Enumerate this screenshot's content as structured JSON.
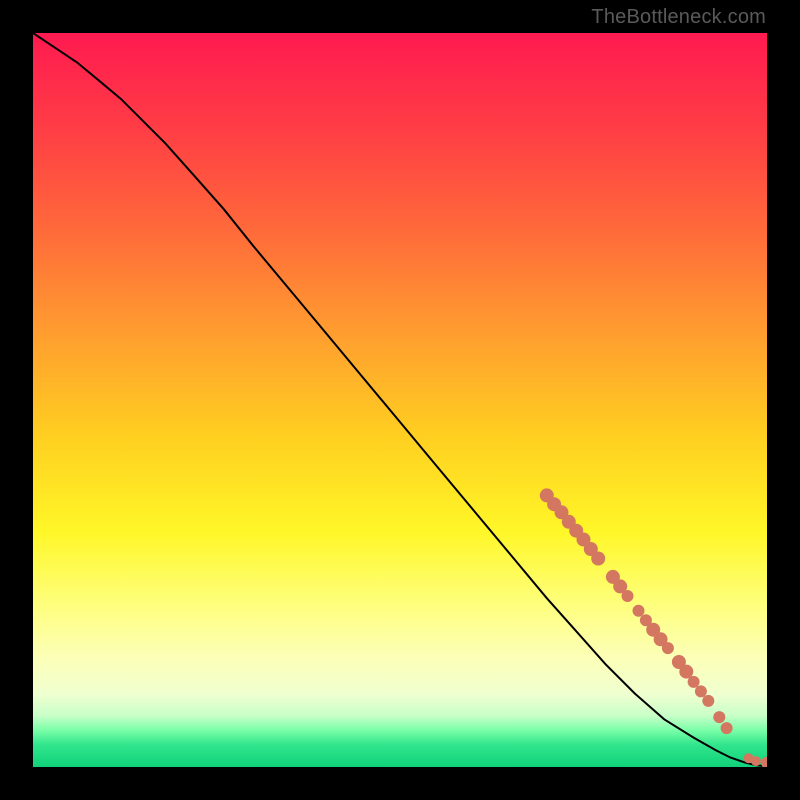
{
  "watermark": "TheBottleneck.com",
  "colors": {
    "dot": "#d47760",
    "line": "#000000",
    "frame": "#000000"
  },
  "chart_data": {
    "type": "line",
    "title": "",
    "xlabel": "",
    "ylabel": "",
    "xlim": [
      0,
      100
    ],
    "ylim": [
      0,
      100
    ],
    "series": [
      {
        "name": "curve",
        "x": [
          0,
          3,
          6,
          9,
          12,
          15,
          18,
          22,
          26,
          30,
          35,
          40,
          45,
          50,
          55,
          60,
          65,
          70,
          74,
          78,
          82,
          86,
          90,
          93,
          95,
          97,
          98.5,
          100
        ],
        "y": [
          100,
          98,
          96,
          93.5,
          91,
          88,
          85,
          80.5,
          76,
          71,
          65,
          59,
          53,
          47,
          41,
          35,
          29,
          23,
          18.5,
          14,
          10,
          6.5,
          4,
          2.3,
          1.3,
          0.6,
          0.25,
          0.1
        ]
      }
    ],
    "dots": {
      "name": "markers",
      "points": [
        {
          "x": 70.0,
          "y": 37.0,
          "r": 7
        },
        {
          "x": 71.0,
          "y": 35.8,
          "r": 7
        },
        {
          "x": 72.0,
          "y": 34.7,
          "r": 7
        },
        {
          "x": 73.0,
          "y": 33.4,
          "r": 7
        },
        {
          "x": 74.0,
          "y": 32.2,
          "r": 7
        },
        {
          "x": 75.0,
          "y": 31.0,
          "r": 7
        },
        {
          "x": 76.0,
          "y": 29.7,
          "r": 7
        },
        {
          "x": 77.0,
          "y": 28.4,
          "r": 7
        },
        {
          "x": 79.0,
          "y": 25.9,
          "r": 7
        },
        {
          "x": 80.0,
          "y": 24.6,
          "r": 7
        },
        {
          "x": 81.0,
          "y": 23.3,
          "r": 6
        },
        {
          "x": 82.5,
          "y": 21.3,
          "r": 6
        },
        {
          "x": 83.5,
          "y": 20.0,
          "r": 6
        },
        {
          "x": 84.5,
          "y": 18.7,
          "r": 7
        },
        {
          "x": 85.5,
          "y": 17.4,
          "r": 7
        },
        {
          "x": 86.5,
          "y": 16.2,
          "r": 6
        },
        {
          "x": 88.0,
          "y": 14.3,
          "r": 7
        },
        {
          "x": 89.0,
          "y": 13.0,
          "r": 7
        },
        {
          "x": 90.0,
          "y": 11.6,
          "r": 6
        },
        {
          "x": 91.0,
          "y": 10.3,
          "r": 6
        },
        {
          "x": 92.0,
          "y": 9.0,
          "r": 6
        },
        {
          "x": 93.5,
          "y": 6.8,
          "r": 6
        },
        {
          "x": 94.5,
          "y": 5.3,
          "r": 6
        },
        {
          "x": 97.5,
          "y": 1.2,
          "r": 5
        },
        {
          "x": 98.5,
          "y": 0.8,
          "r": 5
        },
        {
          "x": 100.0,
          "y": 0.6,
          "r": 6
        },
        {
          "x": 101.0,
          "y": 0.6,
          "r": 6
        }
      ]
    }
  }
}
